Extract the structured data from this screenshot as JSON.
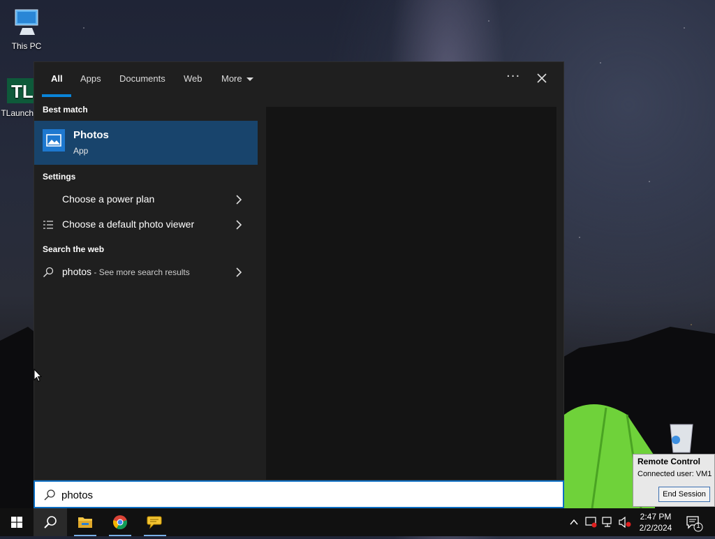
{
  "desktop": {
    "icons": [
      {
        "label": "This PC",
        "icon": "computer-icon"
      },
      {
        "label": "TLauncher",
        "icon": "tlauncher-icon"
      }
    ]
  },
  "search_panel": {
    "tabs": [
      {
        "label": "All",
        "active": true
      },
      {
        "label": "Apps"
      },
      {
        "label": "Documents"
      },
      {
        "label": "Web"
      },
      {
        "label": "More"
      }
    ],
    "options_icon": "ellipsis-icon",
    "close_icon": "close-icon",
    "best_match": {
      "heading": "Best match",
      "title": "Photos",
      "subtitle": "App",
      "icon": "photos-app-icon"
    },
    "settings": {
      "heading": "Settings",
      "items": [
        {
          "label": "Choose a power plan",
          "icon": ""
        },
        {
          "label": "Choose a default photo viewer",
          "icon": "list-settings-icon"
        }
      ]
    },
    "web": {
      "heading": "Search the web",
      "query": "photos",
      "suffix": " - See more search results"
    }
  },
  "search_box": {
    "value": "photos"
  },
  "remote_control": {
    "title": "Remote Control",
    "connected": "Connected user: VM1",
    "button": "End Session"
  },
  "taskbar": {
    "apps": [
      "windows-start-icon",
      "search-icon",
      "file-explorer-icon",
      "chrome-icon",
      "chat-icon"
    ],
    "clock_time": "2:47 PM",
    "clock_date": "2/2/2024",
    "notification_count": "1"
  },
  "colors": {
    "accent": "#0a84d8",
    "best_match_bg": "#18446c",
    "panel_bg": "#1f1f1f"
  }
}
